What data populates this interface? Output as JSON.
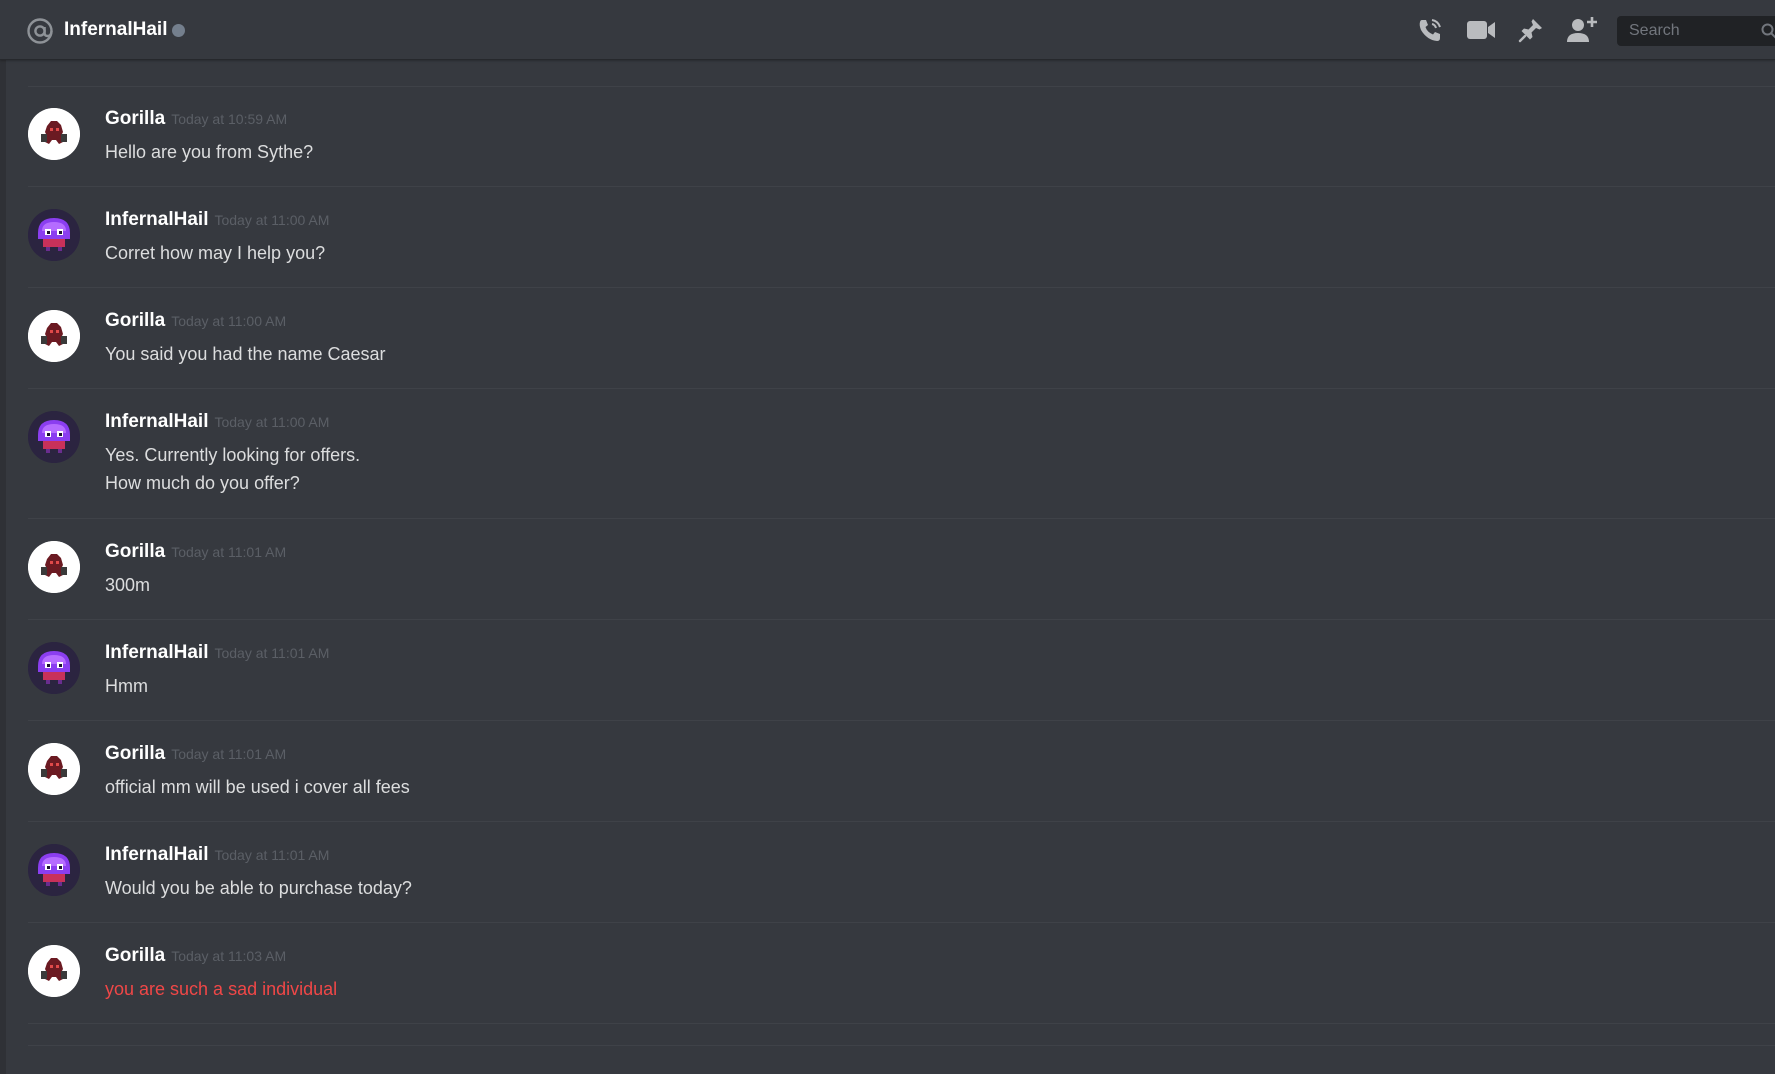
{
  "header": {
    "title": "InfernalHail",
    "status": "offline",
    "search_placeholder": "Search",
    "icons": [
      "at-icon",
      "call-icon",
      "video-icon",
      "pin-icon",
      "add-user-icon",
      "search-icon"
    ]
  },
  "colors": {
    "background": "#36393f",
    "text": "#dcddde",
    "username": "#ffffff",
    "timestamp": "#5b5f66",
    "highlight_text": "#f04747",
    "status_offline": "#747f8d"
  },
  "messages": [
    {
      "author": "Gorilla",
      "timestamp": "Today at 10:59 AM",
      "lines": [
        "Hello are you from Sythe?"
      ]
    },
    {
      "author": "InfernalHail",
      "timestamp": "Today at 11:00 AM",
      "lines": [
        "Corret how may I help you?"
      ]
    },
    {
      "author": "Gorilla",
      "timestamp": "Today at 11:00 AM",
      "lines": [
        "You said you had the name Caesar"
      ]
    },
    {
      "author": "InfernalHail",
      "timestamp": "Today at 11:00 AM",
      "lines": [
        "Yes. Currently looking for offers.",
        "How much do you offer?"
      ]
    },
    {
      "author": "Gorilla",
      "timestamp": "Today at 11:01 AM",
      "lines": [
        "300m"
      ]
    },
    {
      "author": "InfernalHail",
      "timestamp": "Today at 11:01 AM",
      "lines": [
        "Hmm"
      ]
    },
    {
      "author": "Gorilla",
      "timestamp": "Today at 11:01 AM",
      "lines": [
        "official mm will be used i cover all fees"
      ]
    },
    {
      "author": "InfernalHail",
      "timestamp": "Today at 11:01 AM",
      "lines": [
        "Would you be able to purchase today?"
      ]
    },
    {
      "author": "Gorilla",
      "timestamp": "Today at 11:03 AM",
      "lines": [
        "you are such a sad individual"
      ]
    }
  ]
}
